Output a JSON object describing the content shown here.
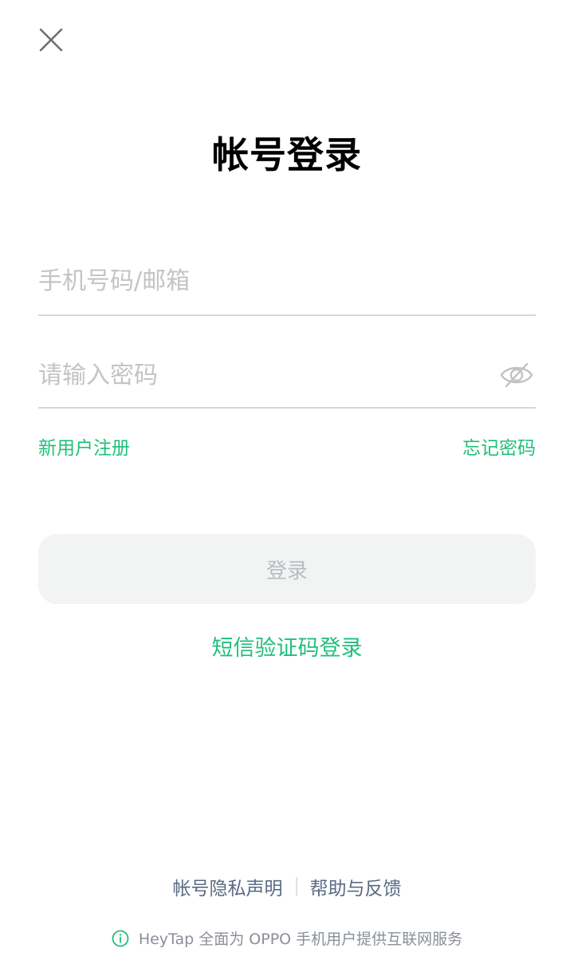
{
  "header": {
    "close_icon": "close-icon"
  },
  "title": "帐号登录",
  "form": {
    "account_placeholder": "手机号码/邮箱",
    "account_value": "",
    "password_placeholder": "请输入密码",
    "password_value": "",
    "password_toggle_icon": "eye-hidden-icon"
  },
  "links": {
    "register": "新用户注册",
    "forgot": "忘记密码"
  },
  "login_button": "登录",
  "sms_login": "短信验证码登录",
  "footer": {
    "privacy": "帐号隐私声明",
    "help": "帮助与反馈",
    "notice": "HeyTap 全面为 OPPO 手机用户提供互联网服务",
    "info_icon": "info-icon"
  },
  "colors": {
    "accent": "#1fbf7a",
    "footer_link": "#5a6a84",
    "button_bg": "#f2f3f3",
    "button_text": "#b8bcc2"
  }
}
